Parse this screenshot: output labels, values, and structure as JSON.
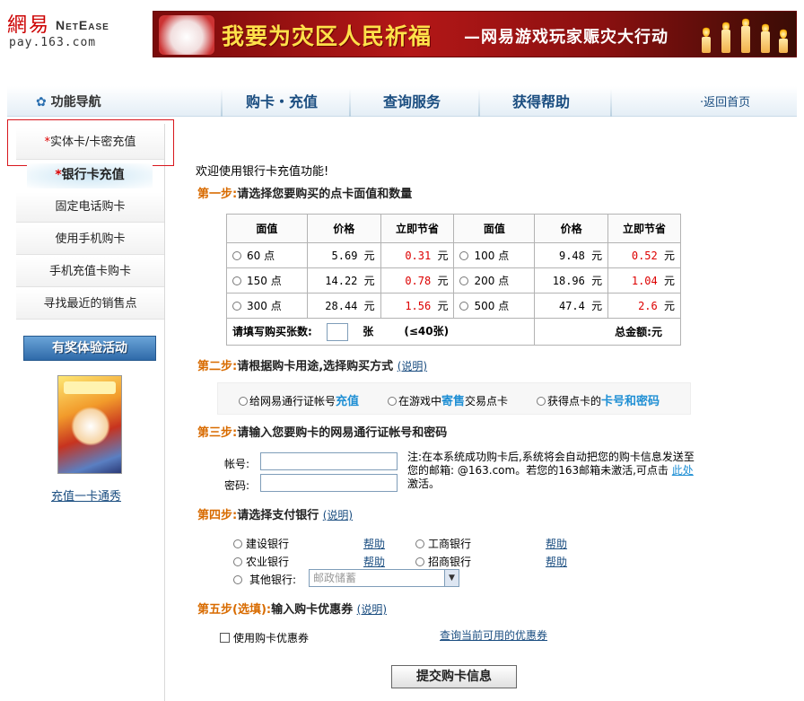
{
  "header": {
    "logo_cn": "網易",
    "logo_en": "NetEase",
    "logo_url": "pay.163.com",
    "banner_title": "我要为灾区人民祈福",
    "banner_sub": "—网易游戏玩家赈灾大行动"
  },
  "nav": {
    "guide": "功能导航",
    "tabs": [
      "购卡・充值",
      "查询服务",
      "获得帮助"
    ],
    "home": "·返回首页"
  },
  "sidebar": {
    "items": [
      {
        "star": "*",
        "label": "实体卡/卡密充值"
      },
      {
        "star": "*",
        "label": "银行卡充值"
      },
      {
        "label": "固定电话购卡"
      },
      {
        "label": "使用手机购卡"
      },
      {
        "label": "手机充值卡购卡"
      },
      {
        "label": "寻找最近的销售点"
      }
    ],
    "promo_button": "有奖体验活动",
    "promo_link": "充值一卡通秀"
  },
  "main": {
    "welcome": "欢迎使用银行卡充值功能!",
    "step1": {
      "no": "第一步:",
      "text": "请选择您要购买的点卡面值和数量"
    },
    "table": {
      "headers": [
        "面值",
        "价格",
        "立即节省",
        "面值",
        "价格",
        "立即节省"
      ],
      "rows": [
        [
          {
            "value": "60 点",
            "price": "5.69 元",
            "save": "0.31",
            "unit": "元"
          },
          {
            "value": "100 点",
            "price": "9.48 元",
            "save": "0.52",
            "unit": "元"
          }
        ],
        [
          {
            "value": "150 点",
            "price": "14.22 元",
            "save": "0.78",
            "unit": "元"
          },
          {
            "value": "200 点",
            "price": "18.96 元",
            "save": "1.04",
            "unit": "元"
          }
        ],
        [
          {
            "value": "300 点",
            "price": "28.44 元",
            "save": "1.56",
            "unit": "元"
          },
          {
            "value": "500 点",
            "price": "47.4 元",
            "save": "2.6",
            "unit": "元"
          }
        ]
      ],
      "qty_label": "请填写购买张数:",
      "qty_unit": "张",
      "qty_limit": "(≤40张)",
      "total_label": "总金额:",
      "total_unit": "元"
    },
    "step2": {
      "no": "第二步:",
      "text": "请根据购卡用途,选择购买方式",
      "tip": "(说明)"
    },
    "methods": [
      {
        "pre": "给网易通行证帐号",
        "em": "充值",
        "post": ""
      },
      {
        "pre": "在游戏中",
        "em": "寄售",
        "post": "交易点卡"
      },
      {
        "pre": "获得点卡的",
        "em": "卡号和密码",
        "post": ""
      }
    ],
    "step3": {
      "no": "第三步:",
      "text": "请输入您要购卡的网易通行证帐号和密码"
    },
    "account_label": "帐号:",
    "password_label": "密码:",
    "note": "注:在本系统成功购卡后,系统将会自动把您的购卡信息发送至您的邮箱: @163.com。若您的163邮箱未激活,可点击",
    "note_link": "此处",
    "note_end": "激活。",
    "step4": {
      "no": "第四步:",
      "text": "请选择支付银行",
      "tip": "(说明)"
    },
    "banks": [
      {
        "name": "建设银行",
        "help": "帮助"
      },
      {
        "name": "工商银行",
        "help": "帮助"
      },
      {
        "name": "农业银行",
        "help": "帮助"
      },
      {
        "name": "招商银行",
        "help": "帮助"
      }
    ],
    "other_bank_label": "其他银行:",
    "other_bank_selected": "邮政储蓄",
    "step5": {
      "no": "第五步(选填):",
      "text": "输入购卡优惠券",
      "tip": "(说明)"
    },
    "coupon_label": "使用购卡优惠券",
    "coupon_link": "查询当前可用的优惠券",
    "submit": "提交购卡信息"
  },
  "colors": {
    "step_orange": "#d86b00",
    "link_blue": "#1a4d80",
    "save_red": "#dd0000",
    "highlight_red": "#d8171d"
  }
}
